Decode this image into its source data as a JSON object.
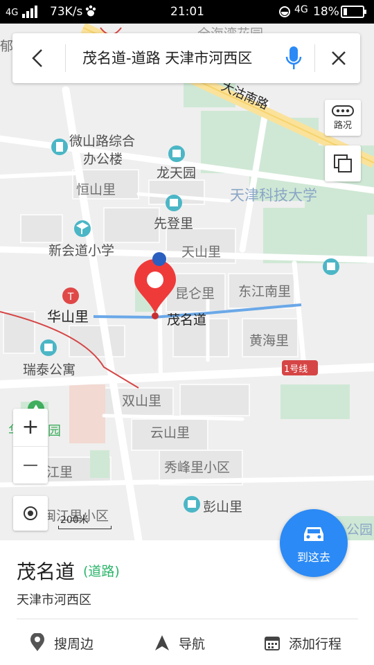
{
  "status_bar": {
    "network_type": "4G",
    "speed": "73K/s",
    "time": "21:01",
    "network_type_right": "4G",
    "battery": "18%"
  },
  "search": {
    "query": "茂名道-道路 天津市河西区"
  },
  "map_controls": {
    "traffic_label": "路况",
    "zoom_in": "+",
    "zoom_out": "—",
    "scale_label": "200米"
  },
  "map_labels": {
    "top_cut": "全海湾花园",
    "left_cut": "郁",
    "dagu_road": "大沽南路",
    "weishan": "微山路综合",
    "weishan2": "办公楼",
    "longtian": "龙天园",
    "hengshan": "恒山里",
    "univ": "天津科技大学",
    "xiandeng": "先登里",
    "xinhui": "新会道小学",
    "tianshan": "天山里",
    "kunlun": "昆仑里",
    "dongjiang": "东江南里",
    "huashan": "华山里",
    "maoming": "茂名道",
    "huanghai": "黄海里",
    "ruitai": "瑞泰公寓",
    "line1": "1号线",
    "shuangshan": "双山里",
    "yunshan": "云山里",
    "park": "华苑公园",
    "jiang": "江里",
    "xiufeng": "秀峰里小区",
    "pengshan": "彭山里",
    "mingjiang": "闽江里小区",
    "gongyuan": "公园"
  },
  "place": {
    "name": "茂名道",
    "type": "(道路)",
    "address": "天津市河西区"
  },
  "actions": {
    "nearby": "搜周边",
    "navigate": "导航",
    "add_trip": "添加行程",
    "go_here": "到这去"
  },
  "colors": {
    "accent": "#2b8af5",
    "pin": "#ef3a3a",
    "road_type": "#2bb56a",
    "metro": "#e04848"
  }
}
